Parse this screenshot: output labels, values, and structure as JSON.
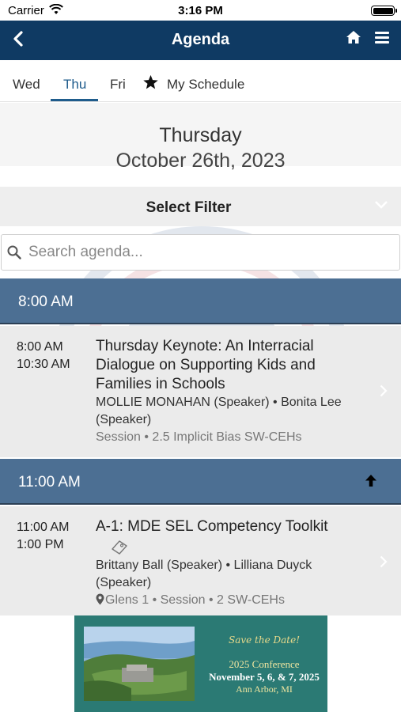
{
  "status_bar": {
    "carrier": "Carrier",
    "time": "3:16 PM"
  },
  "nav": {
    "title": "Agenda"
  },
  "tabs": [
    {
      "label": "Wed",
      "selected": false
    },
    {
      "label": "Thu",
      "selected": true
    },
    {
      "label": "Fri",
      "selected": false
    },
    {
      "label": "My Schedule",
      "selected": false
    }
  ],
  "date_header": {
    "day_of_week": "Thursday",
    "date": "October 26th, 2023"
  },
  "filter": {
    "label": "Select Filter"
  },
  "search": {
    "placeholder": "Search agenda..."
  },
  "time_groups": [
    {
      "time": "8:00 AM",
      "sessions": [
        {
          "start": "8:00 AM",
          "end": "10:30 AM",
          "title": "Thursday Keynote: An Interracial Dialogue on Supporting Kids and Families in Schools",
          "speakers": "MOLLIE MONAHAN (Speaker) • Bonita Lee (Speaker)",
          "meta": "Session • 2.5 Implicit Bias SW-CEHs"
        }
      ]
    },
    {
      "time": "11:00 AM",
      "sessions": [
        {
          "start": "11:00 AM",
          "end": "1:00 PM",
          "title": "A-1: MDE SEL Competency Toolkit",
          "speakers": "Brittany Ball (Speaker) • Lilliana Duyck (Speaker)",
          "meta": "Glens 1 • Session • 2 SW-CEHs"
        }
      ]
    }
  ],
  "banner": {
    "tagline": "Save the Date!",
    "conference": "2025 Conference",
    "dates": "November 5, 6, & 7, 2025",
    "location": "Ann Arbor, MI"
  },
  "colors": {
    "nav_bg": "#0f3a63",
    "tab_active": "#1f5c8c",
    "time_header_bg": "#4c6f93",
    "session_bg": "#ebebeb",
    "banner_bg": "#2b7a74"
  }
}
